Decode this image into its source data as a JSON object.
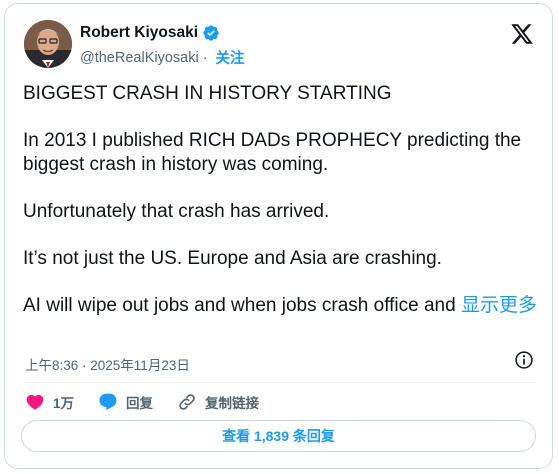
{
  "author": {
    "name": "Robert Kiyosaki",
    "handle": "@theRealKiyosaki",
    "separator": "·",
    "follow_label": "关注",
    "verified_color": "#1d9bf0"
  },
  "tweet": {
    "paragraphs": [
      "BIGGEST CRASH IN HISTORY STARTING",
      "In 2013 I published RICH DADs PROPHECY predicting the biggest crash in history was coming.",
      "Unfortunately that crash has arrived.",
      "It’s not just the US.  Europe and Asia are crashing.",
      "AI will wipe out jobs and when jobs crash office and"
    ],
    "show_more_label": "显示更多"
  },
  "meta": {
    "timestamp": "上午8:36 · 2025年11月23日"
  },
  "actions": {
    "likes_count": "1万",
    "reply_label": "回复",
    "copy_link_label": "复制链接"
  },
  "replies_button_label": "查看 1,839 条回复",
  "colors": {
    "accent": "#1d9bf0",
    "like": "#f91880",
    "muted": "#536471"
  }
}
